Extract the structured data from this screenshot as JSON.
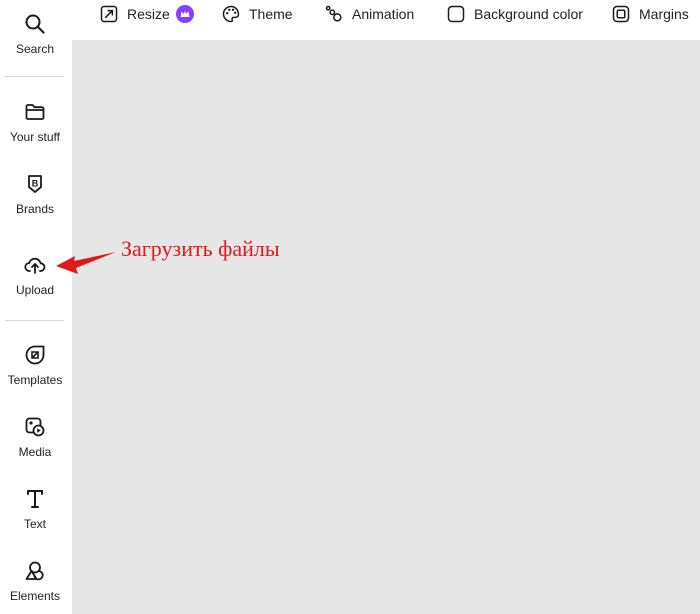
{
  "sidebar": {
    "items": [
      {
        "id": "search",
        "label": "Search",
        "icon": "search-icon"
      },
      {
        "id": "your-stuff",
        "label": "Your stuff",
        "icon": "folder-icon"
      },
      {
        "id": "brands",
        "label": "Brands",
        "icon": "brand-icon"
      },
      {
        "id": "upload",
        "label": "Upload",
        "icon": "cloud-upload-icon"
      },
      {
        "id": "templates",
        "label": "Templates",
        "icon": "templates-icon"
      },
      {
        "id": "media",
        "label": "Media",
        "icon": "media-icon"
      },
      {
        "id": "text",
        "label": "Text",
        "icon": "text-icon"
      },
      {
        "id": "elements",
        "label": "Elements",
        "icon": "elements-icon"
      }
    ]
  },
  "toolbar": {
    "resize_label": "Resize",
    "resize_badge": "crown-icon",
    "theme_label": "Theme",
    "animation_label": "Animation",
    "background_label": "Background color",
    "margins_label": "Margins"
  },
  "annotation": {
    "text": "Загрузить файлы",
    "color": "#e0191c"
  },
  "colors": {
    "canvas": "#e6e6e6",
    "premium_badge": "#8b3dff"
  }
}
